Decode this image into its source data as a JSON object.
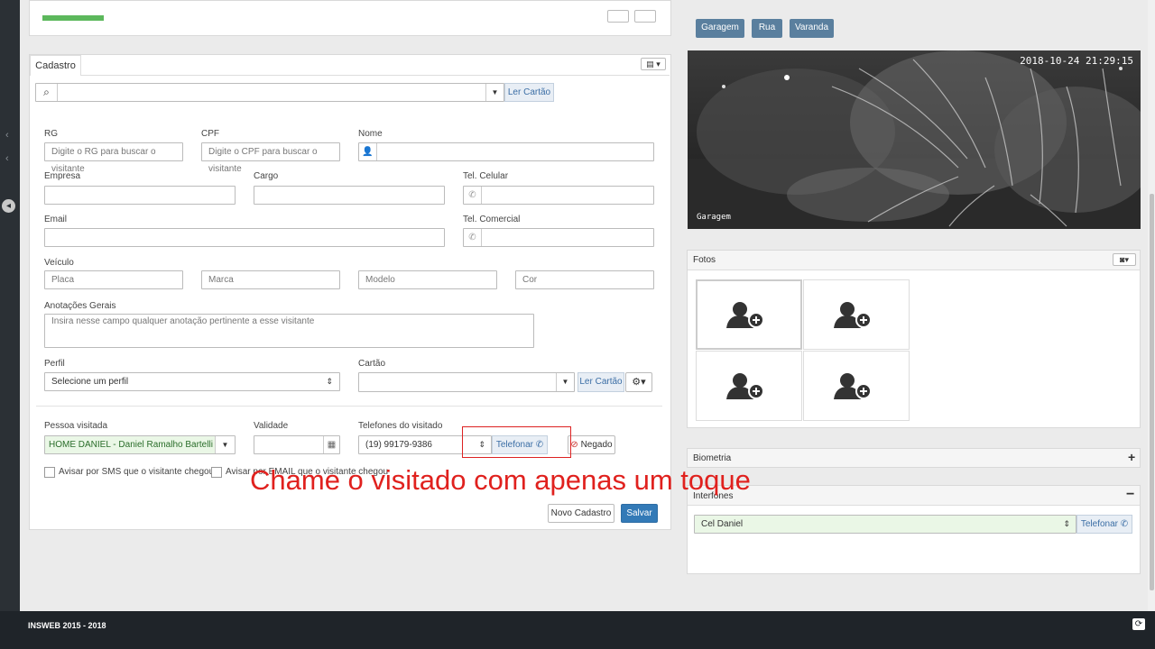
{
  "cadastro": {
    "tab": "Cadastro",
    "ler_cartao": "Ler Cartão",
    "rg": {
      "label": "RG",
      "placeholder": "Digite o RG para buscar o visitante"
    },
    "cpf": {
      "label": "CPF",
      "placeholder": "Digite o CPF para buscar o visitante"
    },
    "nome": {
      "label": "Nome"
    },
    "empresa": {
      "label": "Empresa"
    },
    "cargo": {
      "label": "Cargo"
    },
    "tel_celular": {
      "label": "Tel. Celular"
    },
    "email": {
      "label": "Email"
    },
    "tel_comercial": {
      "label": "Tel. Comercial"
    },
    "veiculo": {
      "label": "Veículo",
      "placa": "Placa",
      "marca": "Marca",
      "modelo": "Modelo",
      "cor": "Cor"
    },
    "anotacoes": {
      "label": "Anotações Gerais",
      "placeholder": "Insira nesse campo qualquer anotação pertinente a esse visitante"
    },
    "perfil": {
      "label": "Perfil",
      "value": "Selecione um perfil"
    },
    "cartao": {
      "label": "Cartão",
      "ler": "Ler Cartão"
    },
    "pessoa": {
      "label": "Pessoa visitada",
      "value": "HOME DANIEL - Daniel Ramalho Bartelli"
    },
    "validade": {
      "label": "Validade"
    },
    "telefones": {
      "label": "Telefones do visitado",
      "value": "(19) 99179-9386",
      "telefonar": "Telefonar"
    },
    "negado": "Negado",
    "avisar_sms": "Avisar por SMS que o visitante chegou",
    "avisar_email": "Avisar por EMAIL que o visitante chegou",
    "novo": "Novo Cadastro",
    "salvar": "Salvar"
  },
  "cameras": {
    "buttons": [
      "Garagem",
      "Rua",
      "Varanda"
    ],
    "timestamp": "2018-10-24 21:29:15",
    "label": "Garagem"
  },
  "fotos": {
    "title": "Fotos"
  },
  "biometria": {
    "title": "Biometria"
  },
  "interfones": {
    "title": "Interfones",
    "value": "Cel Daniel",
    "telefonar": "Telefonar"
  },
  "footer": {
    "text": "INSWEB 2015 - 2018"
  },
  "overlay": {
    "text": "Chame o visitado com apenas um toque"
  },
  "colors": {
    "accent": "#337ab7",
    "overlay": "#e0211e",
    "success_bg": "#eaf7e6"
  }
}
